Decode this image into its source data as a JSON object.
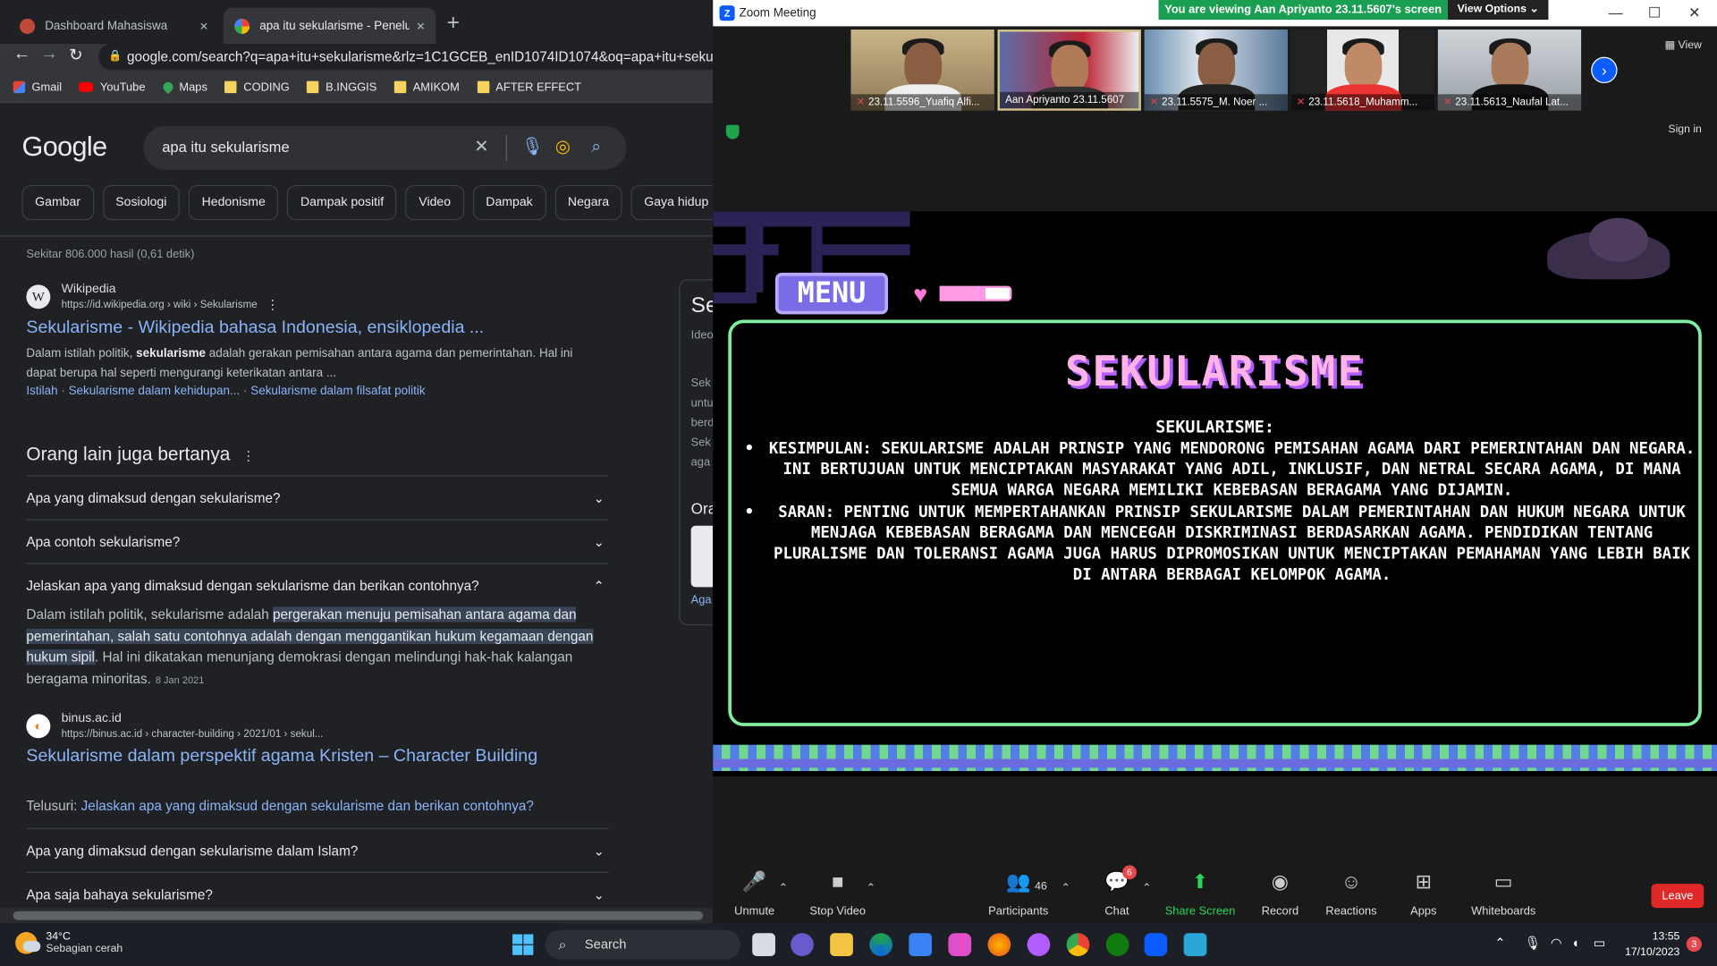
{
  "chrome": {
    "tabs": [
      {
        "label": "Dashboard Mahasiswa",
        "close": "×",
        "color": "#c04a3a"
      },
      {
        "label": "apa itu sekularisme - Penelusura",
        "close": "×",
        "color": "#ffffff"
      }
    ],
    "new_tab": "+",
    "url": "google.com/search?q=apa+itu+sekularisme&rlz=1C1GCEB_enID1074ID1074&oq=apa+itu+sekularisme&",
    "bookmarks": [
      {
        "label": "Gmail",
        "icon": "gmail-icon"
      },
      {
        "label": "YouTube",
        "icon": "youtube-icon"
      },
      {
        "label": "Maps",
        "icon": "maps-icon"
      },
      {
        "label": "CODING",
        "icon": "folder-icon"
      },
      {
        "label": "B.INGGIS",
        "icon": "folder-icon"
      },
      {
        "label": "AMIKOM",
        "icon": "folder-icon"
      },
      {
        "label": "AFTER EFFECT",
        "icon": "folder-icon"
      }
    ]
  },
  "google": {
    "logo": "Google",
    "query": "apa itu sekularisme",
    "chips": [
      "Gambar",
      "Sosiologi",
      "Hedonisme",
      "Dampak positif",
      "Video",
      "Dampak",
      "Negara",
      "Gaya hidup"
    ],
    "stats": "Sekitar 806.000 hasil (0,61 detik)",
    "result1": {
      "source": "Wikipedia",
      "url": "https://id.wikipedia.org › wiki › Sekularisme",
      "title": "Sekularisme - Wikipedia bahasa Indonesia, ensiklopedia ...",
      "snippet_pre": "Dalam istilah politik, ",
      "snippet_bold": "sekularisme",
      "snippet_post": " adalah gerakan pemisahan antara agama dan pemerintahan. Hal ini dapat berupa hal seperti mengurangi keterikatan antara ...",
      "sitelinks": [
        "Istilah",
        "Sekularisme dalam kehidupan...",
        "Sekularisme dalam filsafat politik"
      ]
    },
    "paa_title": "Orang lain juga bertanya",
    "questions": [
      "Apa yang dimaksud dengan sekularisme?",
      "Apa contoh sekularisme?",
      "Jelaskan apa yang dimaksud dengan sekularisme dan berikan contohnya?"
    ],
    "answer": {
      "pre": "Dalam istilah politik, sekularisme adalah ",
      "highlight": "pergerakan menuju pemisahan antara agama dan pemerintahan, salah satu contohnya adalah dengan menggantikan hukum kegamaan dengan hukum sipil",
      "post": ". Hal ini dikatakan menunjang demokrasi dengan melindungi hak-hak kalangan beragama minoritas.",
      "date": "8 Jan 2021"
    },
    "result2": {
      "source": "binus.ac.id",
      "url": "https://binus.ac.id › character-building › 2021/01 › sekul...",
      "title": "Sekularisme dalam perspektif agama Kristen – Character Building"
    },
    "explore_label": "Telusuri: ",
    "explore_link": "Jelaskan apa yang dimaksud dengan sekularisme dan berikan contohnya?",
    "questions2": [
      "Apa yang dimaksud dengan sekularisme dalam Islam?",
      "Apa saja bahaya sekularisme?"
    ],
    "panel_text": [
      "Se",
      "Ideo",
      "Sek",
      "untu",
      "berd",
      "Sek",
      "aga",
      "Ora",
      "Aga"
    ]
  },
  "zoom": {
    "title": "Zoom Meeting",
    "viewing": "You are viewing Aan Apriyanto 23.11.5607's screen",
    "view_options": "View Options",
    "view_label": "View",
    "signin": "Sign in",
    "participants": [
      "23.11.5596_Yuafiq Alfi...",
      "Aan Apriyanto 23.11.5607",
      "23.11.5575_M. Noer ...",
      "23.11.5618_Muhamm...",
      "23.11.5613_Naufal Lat..."
    ],
    "share": {
      "menu": "MENU",
      "title": "SEKULARISME",
      "subtitle": "SEKULARISME:",
      "points": [
        "KESIMPULAN: SEKULARISME ADALAH PRINSIP YANG MENDORONG PEMISAHAN AGAMA DARI PEMERINTAHAN DAN NEGARA. INI BERTUJUAN UNTUK MENCIPTAKAN MASYARAKAT YANG ADIL, INKLUSIF, DAN NETRAL SECARA AGAMA, DI MANA SEMUA WARGA NEGARA MEMILIKI KEBEBASAN BERAGAMA YANG DIJAMIN.",
        "SARAN: PENTING UNTUK MEMPERTAHANKAN PRINSIP SEKULARISME DALAM PEMERINTAHAN DAN HUKUM NEGARA UNTUK MENJAGA KEBEBASAN BERAGAMA DAN MENCEGAH DISKRIMINASI BERDASARKAN AGAMA. PENDIDIKAN TENTANG PLURALISME DAN TOLERANSI AGAMA JUGA HARUS DIPROMOSIKAN UNTUK MENCIPTAKAN PEMAHAMAN YANG LEBIH BAIK DI ANTARA BERBAGAI KELOMPOK AGAMA."
      ]
    },
    "toolbar": {
      "unmute": "Unmute",
      "stop_video": "Stop Video",
      "participants": "Participants",
      "participant_count": "46",
      "chat": "Chat",
      "chat_badge": "6",
      "share_screen": "Share Screen",
      "record": "Record",
      "reactions": "Reactions",
      "apps": "Apps",
      "whiteboards": "Whiteboards",
      "leave": "Leave"
    }
  },
  "taskbar": {
    "temp": "34°C",
    "weather": "Sebagian cerah",
    "search": "Search",
    "time": "13:55",
    "date": "17/10/2023",
    "notifications": "3"
  }
}
